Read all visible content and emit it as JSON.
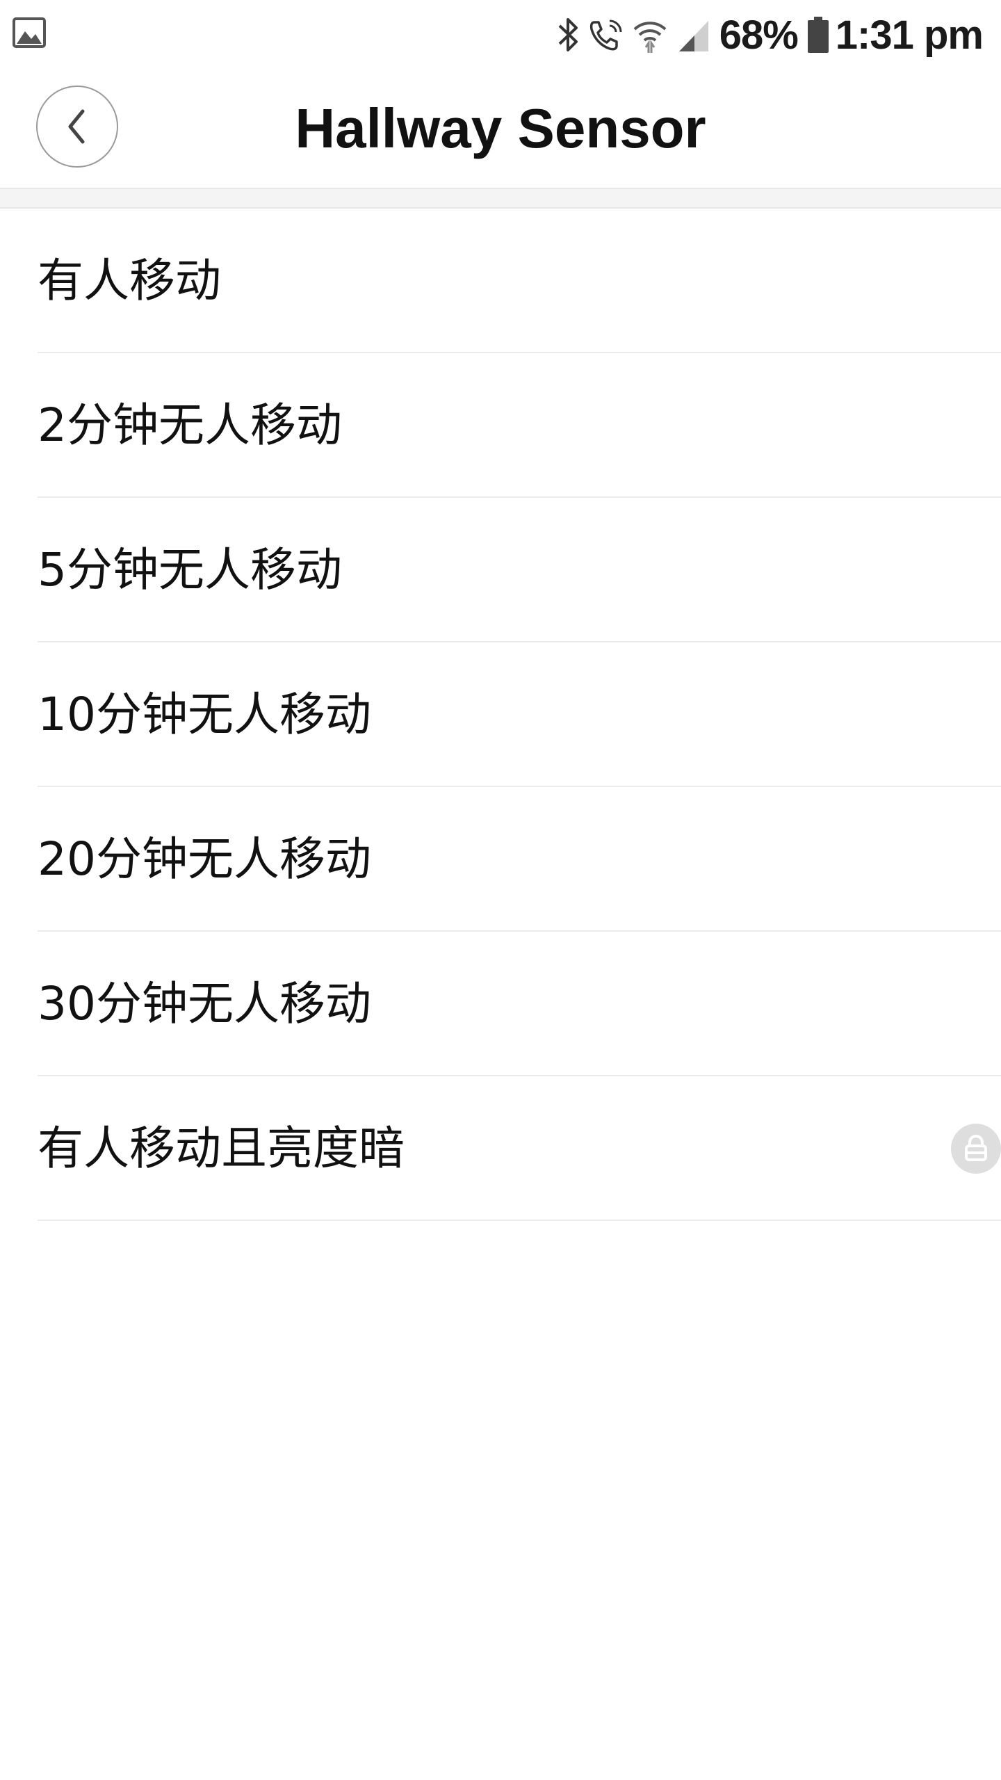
{
  "status_bar": {
    "battery": "68%",
    "time": "1:31 pm",
    "icons": [
      "photo-icon",
      "bluetooth-icon",
      "wifi-calling-icon",
      "wifi-icon",
      "cellular-signal-icon",
      "battery-icon"
    ]
  },
  "header": {
    "title": "Hallway Sensor",
    "back_icon": "chevron-left-icon"
  },
  "options": [
    {
      "label": "有人移动"
    },
    {
      "label": "2分钟无人移动"
    },
    {
      "label": "5分钟无人移动"
    },
    {
      "label": "10分钟无人移动"
    },
    {
      "label": "20分钟无人移动"
    },
    {
      "label": "30分钟无人移动"
    },
    {
      "label": "有人移动且亮度暗",
      "locked": true,
      "badge_icon": "lock-icon"
    }
  ],
  "colors": {
    "background": "#ffffff",
    "text": "#111111",
    "divider": "#ececec",
    "section_gap": "#f4f4f4",
    "lock_badge": "#dedede"
  }
}
